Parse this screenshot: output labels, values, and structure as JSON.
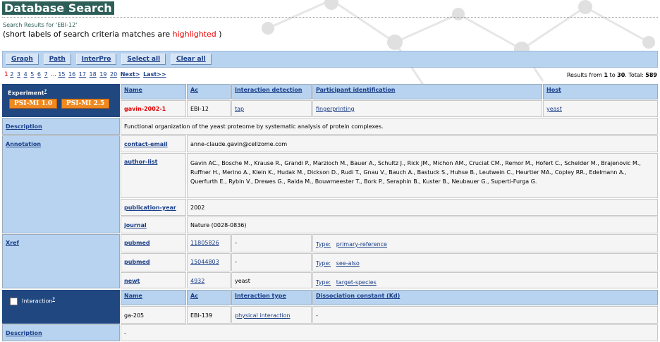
{
  "header": {
    "title": "Database Search"
  },
  "subtitle": {
    "results_for": "Search Results for 'EBI-12'",
    "note_before": "(short labels of search criteria matches are ",
    "note_highlight": "highlighted",
    "note_after": " )"
  },
  "toolbar": {
    "buttons": [
      "Graph",
      "Path",
      "InterPro",
      "Select all",
      "Clear all"
    ]
  },
  "pager": {
    "current": "1",
    "pages": [
      "2",
      "3",
      "4",
      "5",
      "6",
      "7"
    ],
    "ellipsis": "...",
    "pages2": [
      "15",
      "16",
      "17",
      "18",
      "19",
      "20"
    ],
    "next": "Next>",
    "last": "Last>>"
  },
  "results": {
    "prefix": "Results from ",
    "from": "1",
    "to_word": " to ",
    "to": "30",
    "total_label": ".  Total: ",
    "total": "589"
  },
  "experiment": {
    "label": "Experiment",
    "sup": "?",
    "badges": [
      "PSI-MI 1.0",
      "PSI-MI 2.5"
    ],
    "headers": [
      "Name",
      "Ac",
      "Interaction detection",
      "Participant identification",
      "Host"
    ],
    "row": {
      "name": "gavin-2002-1",
      "ac": "EBI-12",
      "detection": "tap",
      "participant": "fingerprinting",
      "host": "yeast"
    },
    "description_label": "Description",
    "description": "Functional organization of the yeast proteome by systematic analysis of protein complexes.",
    "annotation_label": "Annotation",
    "annotations": [
      {
        "key": "contact-email",
        "value": "anne-claude.gavin@cellzome.com"
      },
      {
        "key": "author-list",
        "value": "Gavin AC., Bosche M., Krause R., Grandi P., Marzioch M., Bauer A., Schultz J., Rick JM., Michon AM., Cruciat CM., Remor M., Hofert C., Schelder M., Brajenovic M., Ruffner H., Merino A., Klein K., Hudak M., Dickson D., Rudi T., Gnau V., Bauch A., Bastuck S., Huhse B., Leutwein C., Heurtier MA., Copley RR., Edelmann A., Querfurth E., Rybin V., Drewes G., Raida M., Bouwmeester T., Bork P., Seraphin B., Kuster B., Neubauer G., Superti-Furga G."
      },
      {
        "key": "publication-year",
        "value": "2002"
      },
      {
        "key": "journal",
        "value": "Nature (0028-0836)"
      }
    ],
    "xref_label": "Xref",
    "xrefs": [
      {
        "db": "pubmed",
        "id": "11805826",
        "note": "-",
        "type_label": "Type:",
        "type": "primary-reference"
      },
      {
        "db": "pubmed",
        "id": "15044803",
        "note": "-",
        "type_label": "Type:",
        "type": "see-also"
      },
      {
        "db": "newt",
        "id": "4932",
        "note": "yeast",
        "type_label": "Type:",
        "type": "target-species"
      }
    ]
  },
  "interaction": {
    "label": "Interaction",
    "sup": "?",
    "headers": [
      "Name",
      "Ac",
      "Interaction type",
      "Dissociation constant (Kd)"
    ],
    "row": {
      "name": "ga-205",
      "ac": "EBI-139",
      "type": "physical interaction",
      "kd": "-"
    },
    "description_label": "Description",
    "description": "-"
  }
}
